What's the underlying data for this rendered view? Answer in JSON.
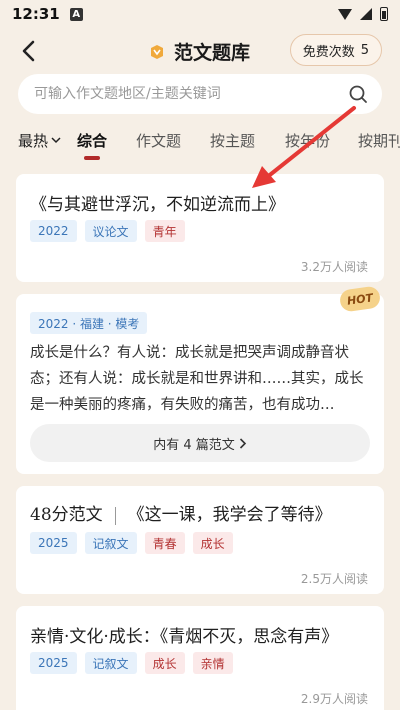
{
  "status": {
    "time": "12:31",
    "indicator": "A"
  },
  "nav": {
    "title": "范文题库",
    "free_label": "免费次数",
    "free_count": "5"
  },
  "search": {
    "placeholder": "可输入作文题地区/主题关键词"
  },
  "tabs": {
    "sort": "最热",
    "items": [
      "综合",
      "作文题",
      "按主题",
      "按年份",
      "按期刊"
    ],
    "active": "综合"
  },
  "cards": [
    {
      "title": "《与其避世浮沉，不如逆流而上》",
      "tags": [
        "2022",
        "议论文",
        "青年"
      ],
      "reads": "3.2万人阅读"
    },
    {
      "badge": "HOT",
      "tag": "2022 · 福建 · 模考",
      "excerpt": "成长是什么？有人说：成长就是把哭声调成静音状态；还有人说：成长就是和世界讲和……其实，成长是一种美丽的疼痛，有失败的痛苦，也有成功…",
      "more": "内有 4 篇范文"
    },
    {
      "title_prefix": "48分范文",
      "title": "《这一课，我学会了等待》",
      "tags": [
        "2025",
        "记叙文",
        "青春",
        "成长"
      ],
      "reads": "2.5万人阅读"
    },
    {
      "title": "亲情·文化·成长：《青烟不灭，思念有声》",
      "tags": [
        "2025",
        "记叙文",
        "成长",
        "亲情"
      ],
      "reads": "2.9万人阅读"
    }
  ],
  "colors": {
    "accent": "#b12a2a",
    "arrow": "#e53935",
    "background": "#f6efe6"
  }
}
